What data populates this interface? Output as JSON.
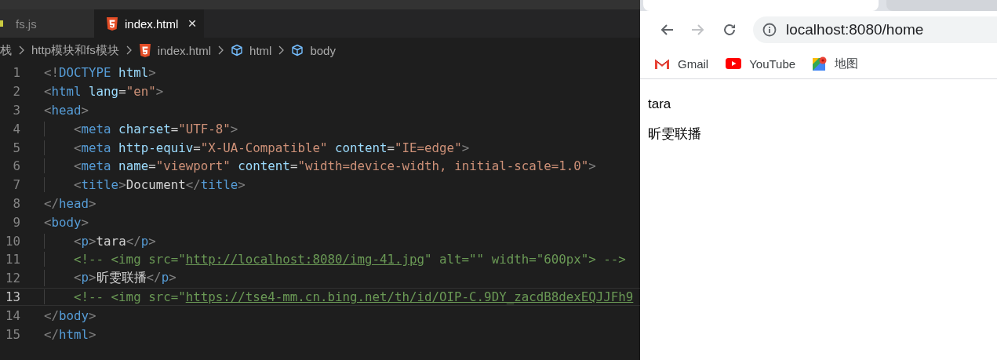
{
  "editor": {
    "tabs": [
      {
        "label": "fs.js",
        "kind": "js",
        "selected": false
      },
      {
        "label": "index.html",
        "kind": "html",
        "selected": true,
        "close": "×"
      }
    ],
    "breadcrumb": [
      {
        "label": "栈",
        "kind": "folder"
      },
      {
        "label": "http模块和fs模块",
        "kind": "folder"
      },
      {
        "label": "index.html",
        "kind": "html"
      },
      {
        "label": "html",
        "kind": "element"
      },
      {
        "label": "body",
        "kind": "element"
      }
    ],
    "lines": [
      {
        "number": "1",
        "selected": false,
        "guide": false,
        "tokens": [
          {
            "kind": "punct",
            "text": "<!"
          },
          {
            "kind": "tag",
            "text": "DOCTYPE"
          },
          {
            "kind": "attr",
            "text": " html"
          },
          {
            "kind": "punct",
            "text": ">"
          }
        ]
      },
      {
        "number": "2",
        "selected": false,
        "guide": false,
        "tokens": [
          {
            "kind": "punct",
            "text": "<"
          },
          {
            "kind": "tag",
            "text": "html"
          },
          {
            "kind": "attr",
            "text": " lang"
          },
          {
            "kind": "text",
            "text": "="
          },
          {
            "kind": "string",
            "text": "\"en\""
          },
          {
            "kind": "punct",
            "text": ">"
          }
        ]
      },
      {
        "number": "3",
        "selected": false,
        "guide": false,
        "tokens": [
          {
            "kind": "punct",
            "text": "<"
          },
          {
            "kind": "tag",
            "text": "head"
          },
          {
            "kind": "punct",
            "text": ">"
          }
        ]
      },
      {
        "number": "4",
        "selected": false,
        "guide": true,
        "tokens": [
          {
            "kind": "punct",
            "text": "    <"
          },
          {
            "kind": "tag",
            "text": "meta"
          },
          {
            "kind": "attr",
            "text": " charset"
          },
          {
            "kind": "text",
            "text": "="
          },
          {
            "kind": "string",
            "text": "\"UTF-8\""
          },
          {
            "kind": "punct",
            "text": ">"
          }
        ]
      },
      {
        "number": "5",
        "selected": false,
        "guide": true,
        "tokens": [
          {
            "kind": "punct",
            "text": "    <"
          },
          {
            "kind": "tag",
            "text": "meta"
          },
          {
            "kind": "attr",
            "text": " http-equiv"
          },
          {
            "kind": "text",
            "text": "="
          },
          {
            "kind": "string",
            "text": "\"X-UA-Compatible\""
          },
          {
            "kind": "attr",
            "text": " content"
          },
          {
            "kind": "text",
            "text": "="
          },
          {
            "kind": "string",
            "text": "\"IE=edge\""
          },
          {
            "kind": "punct",
            "text": ">"
          }
        ]
      },
      {
        "number": "6",
        "selected": false,
        "guide": true,
        "tokens": [
          {
            "kind": "punct",
            "text": "    <"
          },
          {
            "kind": "tag",
            "text": "meta"
          },
          {
            "kind": "attr",
            "text": " name"
          },
          {
            "kind": "text",
            "text": "="
          },
          {
            "kind": "string",
            "text": "\"viewport\""
          },
          {
            "kind": "attr",
            "text": " content"
          },
          {
            "kind": "text",
            "text": "="
          },
          {
            "kind": "string",
            "text": "\"width=device-width, initial-scale=1.0\""
          },
          {
            "kind": "punct",
            "text": ">"
          }
        ]
      },
      {
        "number": "7",
        "selected": false,
        "guide": true,
        "tokens": [
          {
            "kind": "punct",
            "text": "    <"
          },
          {
            "kind": "tag",
            "text": "title"
          },
          {
            "kind": "punct",
            "text": ">"
          },
          {
            "kind": "text",
            "text": "Document"
          },
          {
            "kind": "punct",
            "text": "</"
          },
          {
            "kind": "tag",
            "text": "title"
          },
          {
            "kind": "punct",
            "text": ">"
          }
        ]
      },
      {
        "number": "8",
        "selected": false,
        "guide": false,
        "tokens": [
          {
            "kind": "punct",
            "text": "</"
          },
          {
            "kind": "tag",
            "text": "head"
          },
          {
            "kind": "punct",
            "text": ">"
          }
        ]
      },
      {
        "number": "9",
        "selected": false,
        "guide": false,
        "tokens": [
          {
            "kind": "punct",
            "text": "<"
          },
          {
            "kind": "tag",
            "text": "body"
          },
          {
            "kind": "punct",
            "text": ">"
          }
        ]
      },
      {
        "number": "10",
        "selected": false,
        "guide": true,
        "tokens": [
          {
            "kind": "punct",
            "text": "    <"
          },
          {
            "kind": "tag",
            "text": "p"
          },
          {
            "kind": "punct",
            "text": ">"
          },
          {
            "kind": "text",
            "text": "tara"
          },
          {
            "kind": "punct",
            "text": "</"
          },
          {
            "kind": "tag",
            "text": "p"
          },
          {
            "kind": "punct",
            "text": ">"
          }
        ]
      },
      {
        "number": "11",
        "selected": false,
        "guide": true,
        "tokens": [
          {
            "kind": "comment",
            "text": "    <!-- <img src=\""
          },
          {
            "kind": "link",
            "text": "http://localhost:8080/img-41.jpg"
          },
          {
            "kind": "comment",
            "text": "\" alt=\"\" width=\"600px\"> -->"
          }
        ]
      },
      {
        "number": "12",
        "selected": false,
        "guide": true,
        "tokens": [
          {
            "kind": "punct",
            "text": "    <"
          },
          {
            "kind": "tag",
            "text": "p"
          },
          {
            "kind": "punct",
            "text": ">"
          },
          {
            "kind": "text",
            "text": "昕雯联播"
          },
          {
            "kind": "punct",
            "text": "</"
          },
          {
            "kind": "tag",
            "text": "p"
          },
          {
            "kind": "punct",
            "text": ">"
          }
        ]
      },
      {
        "number": "13",
        "selected": true,
        "guide": true,
        "tokens": [
          {
            "kind": "comment",
            "text": "    <!-- <img src=\""
          },
          {
            "kind": "link",
            "text": "https://tse4-mm.cn.bing.net/th/id/OIP-C.9DY_zacdB8dexEQJJFh9"
          }
        ]
      },
      {
        "number": "14",
        "selected": false,
        "guide": false,
        "tokens": [
          {
            "kind": "punct",
            "text": "</"
          },
          {
            "kind": "tag",
            "text": "body"
          },
          {
            "kind": "punct",
            "text": ">"
          }
        ]
      },
      {
        "number": "15",
        "selected": false,
        "guide": false,
        "tokens": [
          {
            "kind": "punct",
            "text": "</"
          },
          {
            "kind": "tag",
            "text": "html"
          },
          {
            "kind": "punct",
            "text": ">"
          }
        ]
      }
    ]
  },
  "browser": {
    "tabs": [
      {
        "selected": true
      },
      {
        "selected": false
      }
    ],
    "nav_buttons": [
      {
        "kind": "back",
        "disabled": false
      },
      {
        "kind": "forward",
        "disabled": true
      },
      {
        "kind": "reload",
        "disabled": false
      }
    ],
    "address": "localhost:8080/home",
    "bookmarks": [
      {
        "label": "Gmail",
        "kind": "gmail"
      },
      {
        "label": "YouTube",
        "kind": "youtube"
      },
      {
        "label": "地图",
        "kind": "maps"
      }
    ],
    "page": {
      "paragraphs": [
        "tara",
        "昕雯联播"
      ]
    }
  }
}
